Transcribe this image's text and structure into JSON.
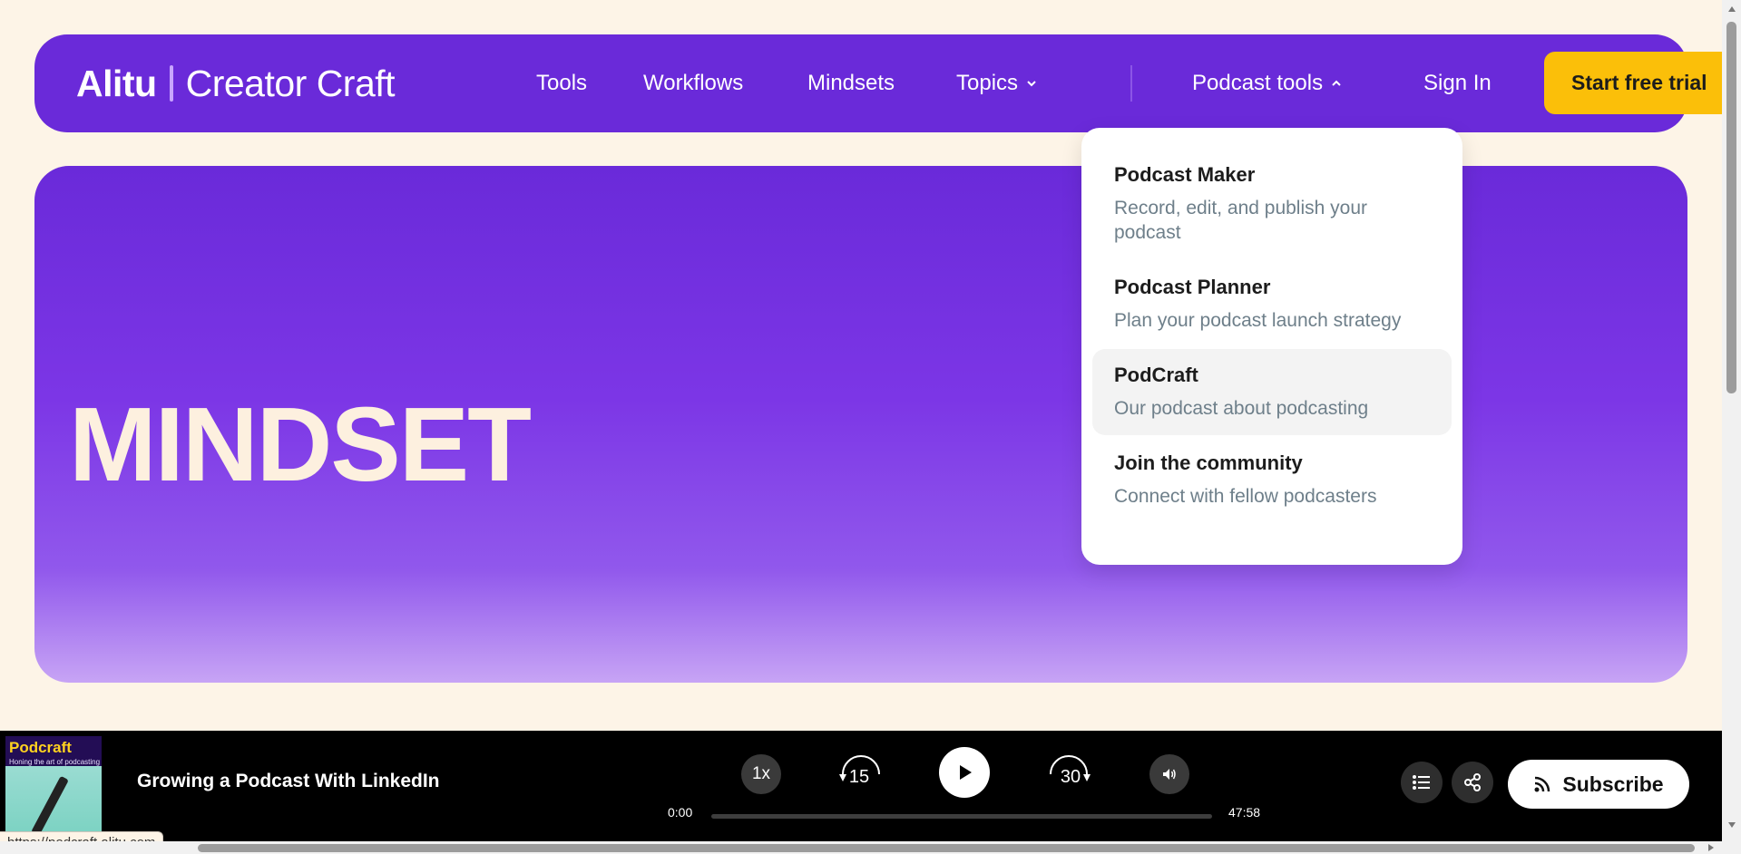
{
  "nav": {
    "brand": "Alitu",
    "product": "Creator Craft",
    "links": [
      "Tools",
      "Workflows",
      "Mindsets",
      "Topics"
    ],
    "podcast_tools": "Podcast tools",
    "sign_in": "Sign In",
    "cta": "Start free trial"
  },
  "hero": {
    "title": "MINDSET"
  },
  "dropdown": {
    "items": [
      {
        "title": "Podcast Maker",
        "desc": "Record, edit, and publish your podcast"
      },
      {
        "title": "Podcast Planner",
        "desc": "Plan your podcast launch strategy"
      },
      {
        "title": "PodCraft",
        "desc": "Our podcast about podcasting"
      },
      {
        "title": "Join the community",
        "desc": "Connect with fellow podcasters"
      }
    ]
  },
  "player": {
    "cover_title": "Podcraft",
    "cover_subtitle": "Honing the art of podcasting",
    "episode_title": "Growing a Podcast With LinkedIn",
    "speed": "1x",
    "skip_back": "15",
    "skip_forward": "30",
    "time_current": "0:00",
    "time_total": "47:58",
    "progress": 0,
    "subscribe": "Subscribe"
  },
  "status_url": "https://podcraft.alitu.com",
  "colors": {
    "nav_bg": "#6a2ad9",
    "cta_bg": "#fbbf09",
    "page_bg": "#fdf4e7",
    "hero_text": "#fdf0df"
  }
}
